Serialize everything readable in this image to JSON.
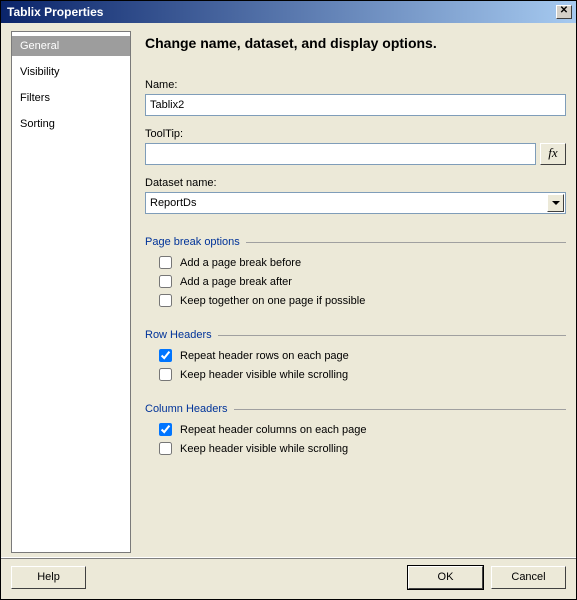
{
  "title": "Tablix Properties",
  "sidebar": {
    "items": [
      {
        "label": "General",
        "selected": true
      },
      {
        "label": "Visibility",
        "selected": false
      },
      {
        "label": "Filters",
        "selected": false
      },
      {
        "label": "Sorting",
        "selected": false
      }
    ]
  },
  "main": {
    "heading": "Change name, dataset, and display options.",
    "name_label": "Name:",
    "name_value": "Tablix2",
    "tooltip_label": "ToolTip:",
    "tooltip_value": "",
    "fx_label": "fx",
    "dataset_label": "Dataset name:",
    "dataset_value": "ReportDs",
    "groups": {
      "page_break": {
        "title": "Page break options",
        "before": {
          "label": "Add a page break before",
          "checked": false
        },
        "after": {
          "label": "Add a page break after",
          "checked": false
        },
        "keep": {
          "label": "Keep together on one page if possible",
          "checked": false
        }
      },
      "row_headers": {
        "title": "Row Headers",
        "repeat": {
          "label": "Repeat header rows on each page",
          "checked": true
        },
        "keep_visible": {
          "label": "Keep header visible while scrolling",
          "checked": false
        }
      },
      "column_headers": {
        "title": "Column Headers",
        "repeat": {
          "label": "Repeat header columns on each page",
          "checked": true
        },
        "keep_visible": {
          "label": "Keep header visible while scrolling",
          "checked": false
        }
      }
    }
  },
  "footer": {
    "help": "Help",
    "ok": "OK",
    "cancel": "Cancel"
  }
}
